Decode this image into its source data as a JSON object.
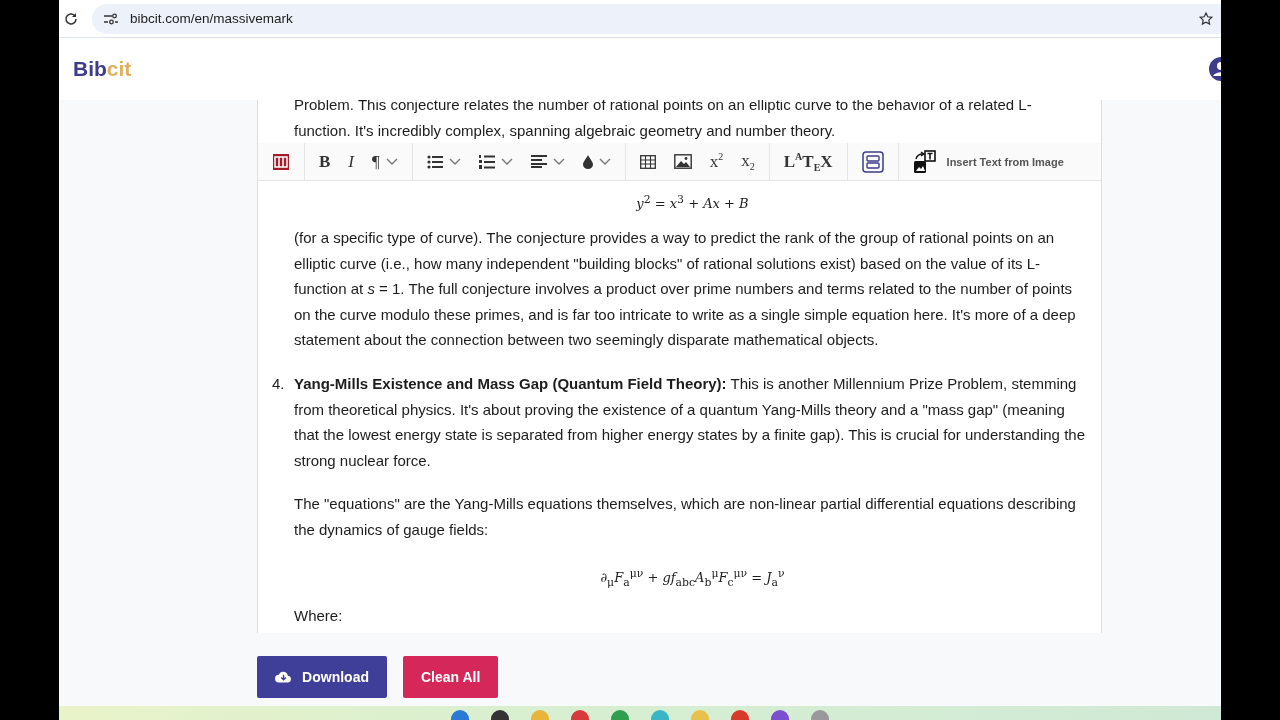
{
  "browser": {
    "url": "bibcit.com/en/massivemark"
  },
  "header": {
    "logo_part_1": "Bib",
    "logo_part_2": "cit"
  },
  "editor": {
    "intro_lines": [
      "Problem. This conjecture relates the number of rational points on an elliptic curve to the behavior of a related L-",
      "function. It's incredibly complex, spanning algebraic geometry and number theory."
    ],
    "toolbar": [
      [
        {
          "kind": "brand"
        }
      ],
      [
        {
          "kind": "bold",
          "label": "B"
        },
        {
          "kind": "italic",
          "label": "I"
        },
        {
          "kind": "paragraph",
          "label": "¶"
        }
      ],
      [
        {
          "kind": "bullets"
        },
        {
          "kind": "numbered"
        },
        {
          "kind": "align"
        },
        {
          "kind": "color"
        }
      ],
      [
        {
          "kind": "table"
        },
        {
          "kind": "image"
        },
        {
          "kind": "superscript",
          "label": "x$^{2}$"
        },
        {
          "kind": "subscript",
          "label": "x$_{2}$"
        }
      ],
      [
        {
          "kind": "latex",
          "label": "L$^{A}$T$_{E}$X"
        }
      ],
      [
        {
          "kind": "box"
        }
      ],
      [
        {
          "kind": "ocr",
          "label": "Insert Text from Image"
        }
      ]
    ],
    "blocks": [
      {
        "kind": "formula",
        "text": "*y*$^{2}$ = *x*$^{3}$ + *Ax* + *B*"
      },
      {
        "kind": "paragraph",
        "text": "(for a specific type of curve). The conjecture provides a way to predict the rank of the group of rational points on an elliptic curve (i.e., how many independent \"building blocks\" of rational solutions exist) based on the value of its L-function at *s* = 1. The full conjecture involves a product over prime numbers and terms related to the number of points on the curve modulo these primes, and is far too intricate to write as a single simple equation here. It's more of a deep statement about the connection between two seemingly disparate mathematical objects."
      },
      {
        "kind": "list_item",
        "number": "4.",
        "text": "**Yang-Mills Existence and Mass Gap (Quantum Field Theory):** This is another Millennium Prize Problem, stemming from theoretical physics. It's about proving the existence of a quantum Yang-Mills theory and a \"mass gap\" (meaning that the lowest energy state is separated from higher energy states by a finite gap). This is crucial for understanding the strong nuclear force."
      },
      {
        "kind": "paragraph",
        "text": "The \"equations\" are the Yang-Mills equations themselves, which are non-linear partial differential equations describing the dynamics of gauge fields:"
      },
      {
        "kind": "formula",
        "text": "∂$_{μ}$*F*$_{a}$$^{μν}$ + *gf*$_{abc}$*A*$_{b}$$^{μ}$*F*$_{c}$$^{μν}$ = *J*$_{a}$$^{ν}$"
      },
      {
        "kind": "paragraph",
        "text": "Where:"
      }
    ]
  },
  "buttons": [
    {
      "kind": "download",
      "label": "Download"
    },
    {
      "kind": "clear",
      "label": "Clean All"
    }
  ]
}
